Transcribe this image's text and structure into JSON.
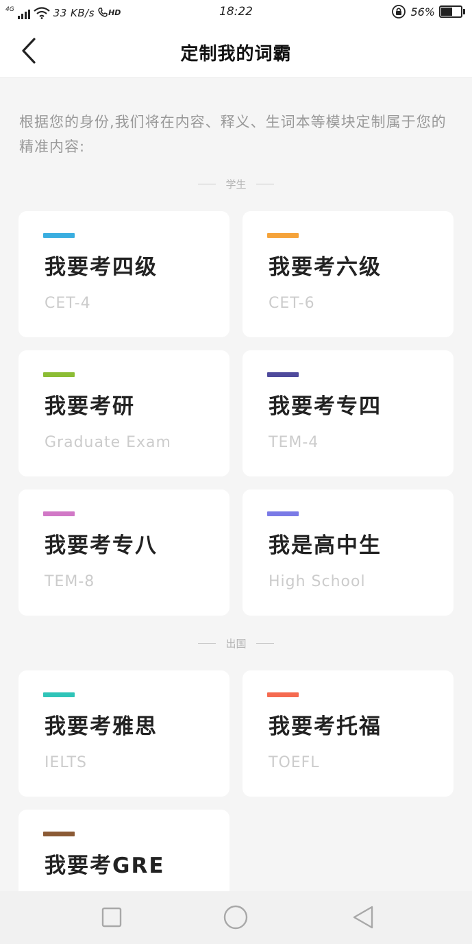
{
  "status_bar": {
    "network": "4G",
    "speed": "33 KB/s",
    "hd": "HD",
    "time": "18:22",
    "battery": "56%",
    "battery_level": 0.56,
    "icons": [
      "signal-icon",
      "wifi-icon",
      "call-hd-icon",
      "rotation-lock-icon",
      "battery-icon"
    ]
  },
  "header": {
    "title": "定制我的词霸",
    "back_icon": "chevron-left-icon"
  },
  "description": "根据您的身份,我们将在内容、释义、生词本等模块定制属于您的精准内容:",
  "sections": [
    {
      "label": "学生",
      "cards": [
        {
          "title": "我要考四级",
          "subtitle": "CET-4",
          "accent": "#3aaee0"
        },
        {
          "title": "我要考六级",
          "subtitle": "CET-6",
          "accent": "#f5a33a"
        },
        {
          "title": "我要考研",
          "subtitle": "Graduate Exam",
          "accent": "#8cbd35"
        },
        {
          "title": "我要考专四",
          "subtitle": "TEM-4",
          "accent": "#4f4a9c"
        },
        {
          "title": "我要考专八",
          "subtitle": "TEM-8",
          "accent": "#d178c6"
        },
        {
          "title": "我是高中生",
          "subtitle": "High School",
          "accent": "#7a7ae6"
        }
      ]
    },
    {
      "label": "出国",
      "cards": [
        {
          "title": "我要考雅思",
          "subtitle": "IELTS",
          "accent": "#2fc4b8"
        },
        {
          "title": "我要考托福",
          "subtitle": "TOEFL",
          "accent": "#f56a50"
        },
        {
          "title": "我要考GRE",
          "subtitle": "",
          "accent": "#8b5a35"
        }
      ]
    }
  ],
  "nav_bar": {
    "icons": [
      "recents-square-icon",
      "home-circle-icon",
      "back-triangle-icon"
    ]
  }
}
